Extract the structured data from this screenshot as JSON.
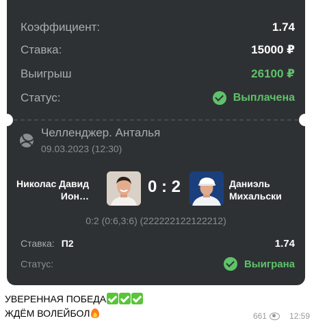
{
  "bet": {
    "coef_label": "Коэффициент:",
    "coef_value": "1.74",
    "stake_label": "Ставка:",
    "stake_value": "15000 ₽",
    "win_label": "Выигрыш",
    "win_value": "26100 ₽",
    "status_label": "Статус:",
    "status_value": "Выплачена"
  },
  "match": {
    "tournament": "Челленджер. Анталья",
    "datetime": "09.03.2023 (12:30)",
    "player1": "Николас Давид Ион…",
    "player2": "Даниэль Михальски",
    "score": "0 : 2",
    "score_detail": "0:2 (0:6,3:6) (222222122122212)",
    "stake_label": "Ставка:",
    "pick": "П2",
    "odds": "1.74",
    "status_label": "Статус:",
    "status_value": "Выиграна"
  },
  "message": {
    "line1": "УВЕРЕННАЯ ПОБЕДА",
    "line2": "ЖДЁМ ВОЛЕЙБОЛ",
    "line1_emoji": [
      "check-mark-button",
      "check-mark-button",
      "check-mark-button"
    ],
    "line2_emoji": [
      "fire"
    ]
  },
  "meta": {
    "views": "661",
    "time": "12:59"
  },
  "colors": {
    "card_bg": "#2e3133",
    "accent_green": "#5fc26b",
    "muted_text": "#a9adb0"
  }
}
